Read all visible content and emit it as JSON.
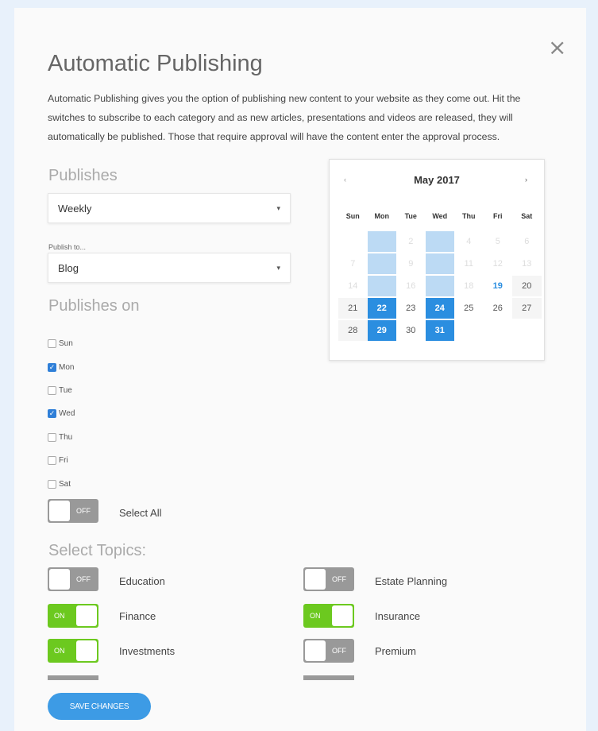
{
  "modal": {
    "title": "Automatic Publishing",
    "description": "Automatic Publishing gives you the option of publishing new content to your website as they come out. Hit the switches to subscribe to each category and as new articles, presentations and videos are released, they will automatically be published. Those that require approval will have the content enter the approval process.",
    "close_icon": "×"
  },
  "publishes": {
    "label": "Publishes",
    "value": "Weekly"
  },
  "publish_to": {
    "label": "Publish to...",
    "value": "Blog"
  },
  "publishes_on": {
    "label": "Publishes on",
    "days": [
      {
        "label": "Sun",
        "checked": false
      },
      {
        "label": "Mon",
        "checked": true
      },
      {
        "label": "Tue",
        "checked": false
      },
      {
        "label": "Wed",
        "checked": true
      },
      {
        "label": "Thu",
        "checked": false
      },
      {
        "label": "Fri",
        "checked": false
      },
      {
        "label": "Sat",
        "checked": false
      }
    ]
  },
  "select_all": {
    "label": "Select All",
    "state": "OFF"
  },
  "topics": {
    "label": "Select Topics:",
    "items": [
      {
        "label": "Education",
        "state": "OFF"
      },
      {
        "label": "Estate Planning",
        "state": "OFF"
      },
      {
        "label": "Finance",
        "state": "ON"
      },
      {
        "label": "Insurance",
        "state": "ON"
      },
      {
        "label": "Investments",
        "state": "ON"
      },
      {
        "label": "Premium",
        "state": "OFF"
      }
    ]
  },
  "save_button": "SAVE CHANGES",
  "calendar": {
    "month": "May 2017",
    "prev_icon": "‹",
    "next_icon": "›",
    "weekdays": [
      "Sun",
      "Mon",
      "Tue",
      "Wed",
      "Thu",
      "Fri",
      "Sat"
    ],
    "weeks": [
      [
        "",
        "1",
        "2",
        "3",
        "4",
        "5",
        "6"
      ],
      [
        "7",
        "8",
        "9",
        "10",
        "11",
        "12",
        "13"
      ],
      [
        "14",
        "15",
        "16",
        "17",
        "18",
        "19",
        "20"
      ],
      [
        "21",
        "22",
        "23",
        "24",
        "25",
        "26",
        "27"
      ],
      [
        "28",
        "29",
        "30",
        "31",
        "",
        "",
        ""
      ]
    ],
    "today": "19",
    "selected": [
      "22",
      "24",
      "29",
      "31"
    ]
  },
  "colors": {
    "accent": "#2b8ee0",
    "toggle_on": "#6cc91f",
    "toggle_off": "#999999"
  }
}
